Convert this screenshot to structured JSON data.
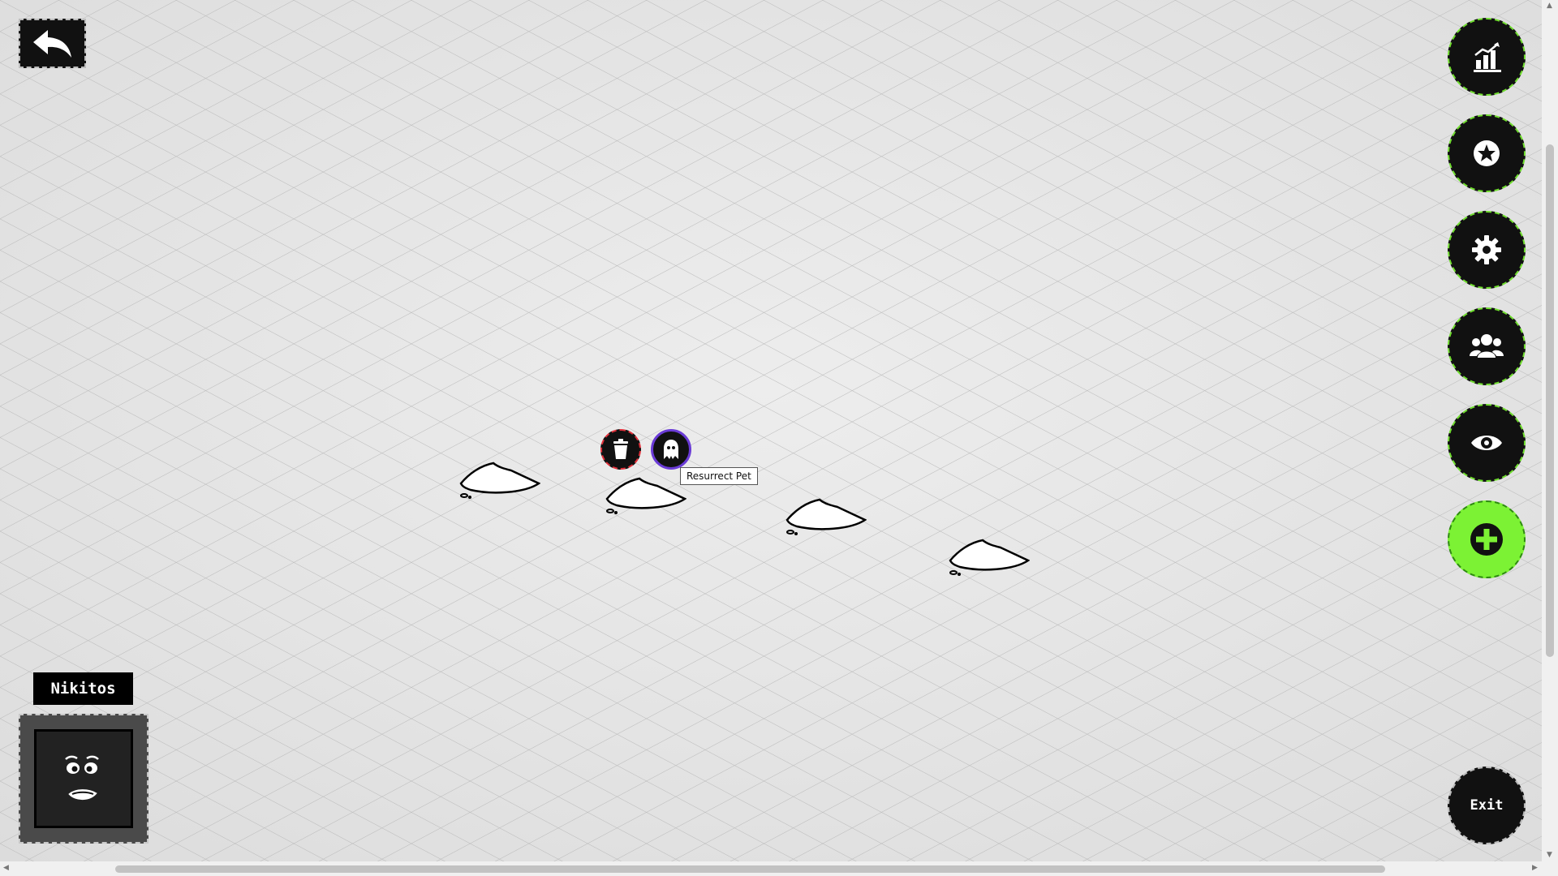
{
  "navigation": {
    "back_icon": "back-arrow-icon"
  },
  "side_menu": {
    "items": [
      {
        "name": "stats",
        "icon": "bar-chart-icon"
      },
      {
        "name": "achievements",
        "icon": "star-badge-icon"
      },
      {
        "name": "settings",
        "icon": "gear-icon"
      },
      {
        "name": "friends",
        "icon": "users-icon"
      },
      {
        "name": "view",
        "icon": "eye-icon"
      },
      {
        "name": "add",
        "icon": "plus-circle-icon"
      }
    ],
    "accent_color": "#6fdc2e",
    "add_color": "#7cf234"
  },
  "exit_button": {
    "label": "Exit"
  },
  "player": {
    "name": "Nikitos"
  },
  "pet_actions": {
    "delete_icon": "trash-icon",
    "resurrect_icon": "ghost-icon",
    "tooltip": "Resurrect Pet",
    "delete_color": "#e0303a",
    "resurrect_color": "#6a3bd6"
  },
  "graves": {
    "count": 4,
    "icon": "grave-mound-icon"
  }
}
